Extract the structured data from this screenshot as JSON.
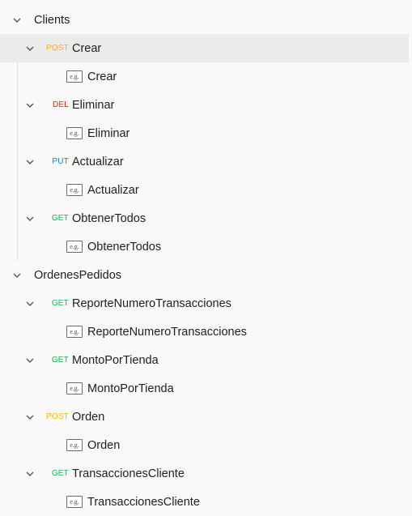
{
  "collections": [
    {
      "name": "Clients",
      "requests": [
        {
          "method": "POST",
          "name": "Crear",
          "example": "Crear"
        },
        {
          "method": "DEL",
          "name": "Eliminar",
          "example": "Eliminar"
        },
        {
          "method": "PUT",
          "name": "Actualizar",
          "example": "Actualizar"
        },
        {
          "method": "GET",
          "name": "ObtenerTodos",
          "example": "ObtenerTodos"
        }
      ]
    },
    {
      "name": "OrdenesPedidos",
      "requests": [
        {
          "method": "GET",
          "name": "ReporteNumeroTransacciones",
          "example": "ReporteNumeroTransacciones"
        },
        {
          "method": "GET",
          "name": "MontoPorTienda",
          "example": "MontoPorTienda"
        },
        {
          "method": "POST",
          "name": "Orden",
          "example": "Orden"
        },
        {
          "method": "GET",
          "name": "TransaccionesCliente",
          "example": "TransaccionesCliente"
        }
      ]
    }
  ],
  "example_badge": "e.g.",
  "method_colors": {
    "POST": "#ffb400",
    "DEL": "#eb2013",
    "PUT": "#097bed",
    "GET": "#0cbb52"
  },
  "selected_request": "Crear"
}
